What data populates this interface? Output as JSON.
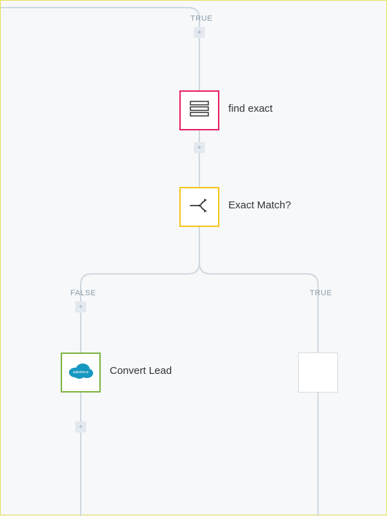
{
  "top_branch_label": "TRUE",
  "nodes": {
    "find_exact": {
      "label": "find exact"
    },
    "exact_match": {
      "label": "Exact Match?"
    },
    "convert_lead": {
      "label": "Convert Lead"
    },
    "right_box": {
      "label": ""
    }
  },
  "branches": {
    "left": "FALSE",
    "right": "TRUE"
  },
  "colors": {
    "find_exact_border": "#e91e63",
    "exact_match_border": "#f5c518",
    "convert_lead_border": "#7cb342",
    "connector": "#cfd8df",
    "add_btn_bg": "#e3e9ee"
  }
}
